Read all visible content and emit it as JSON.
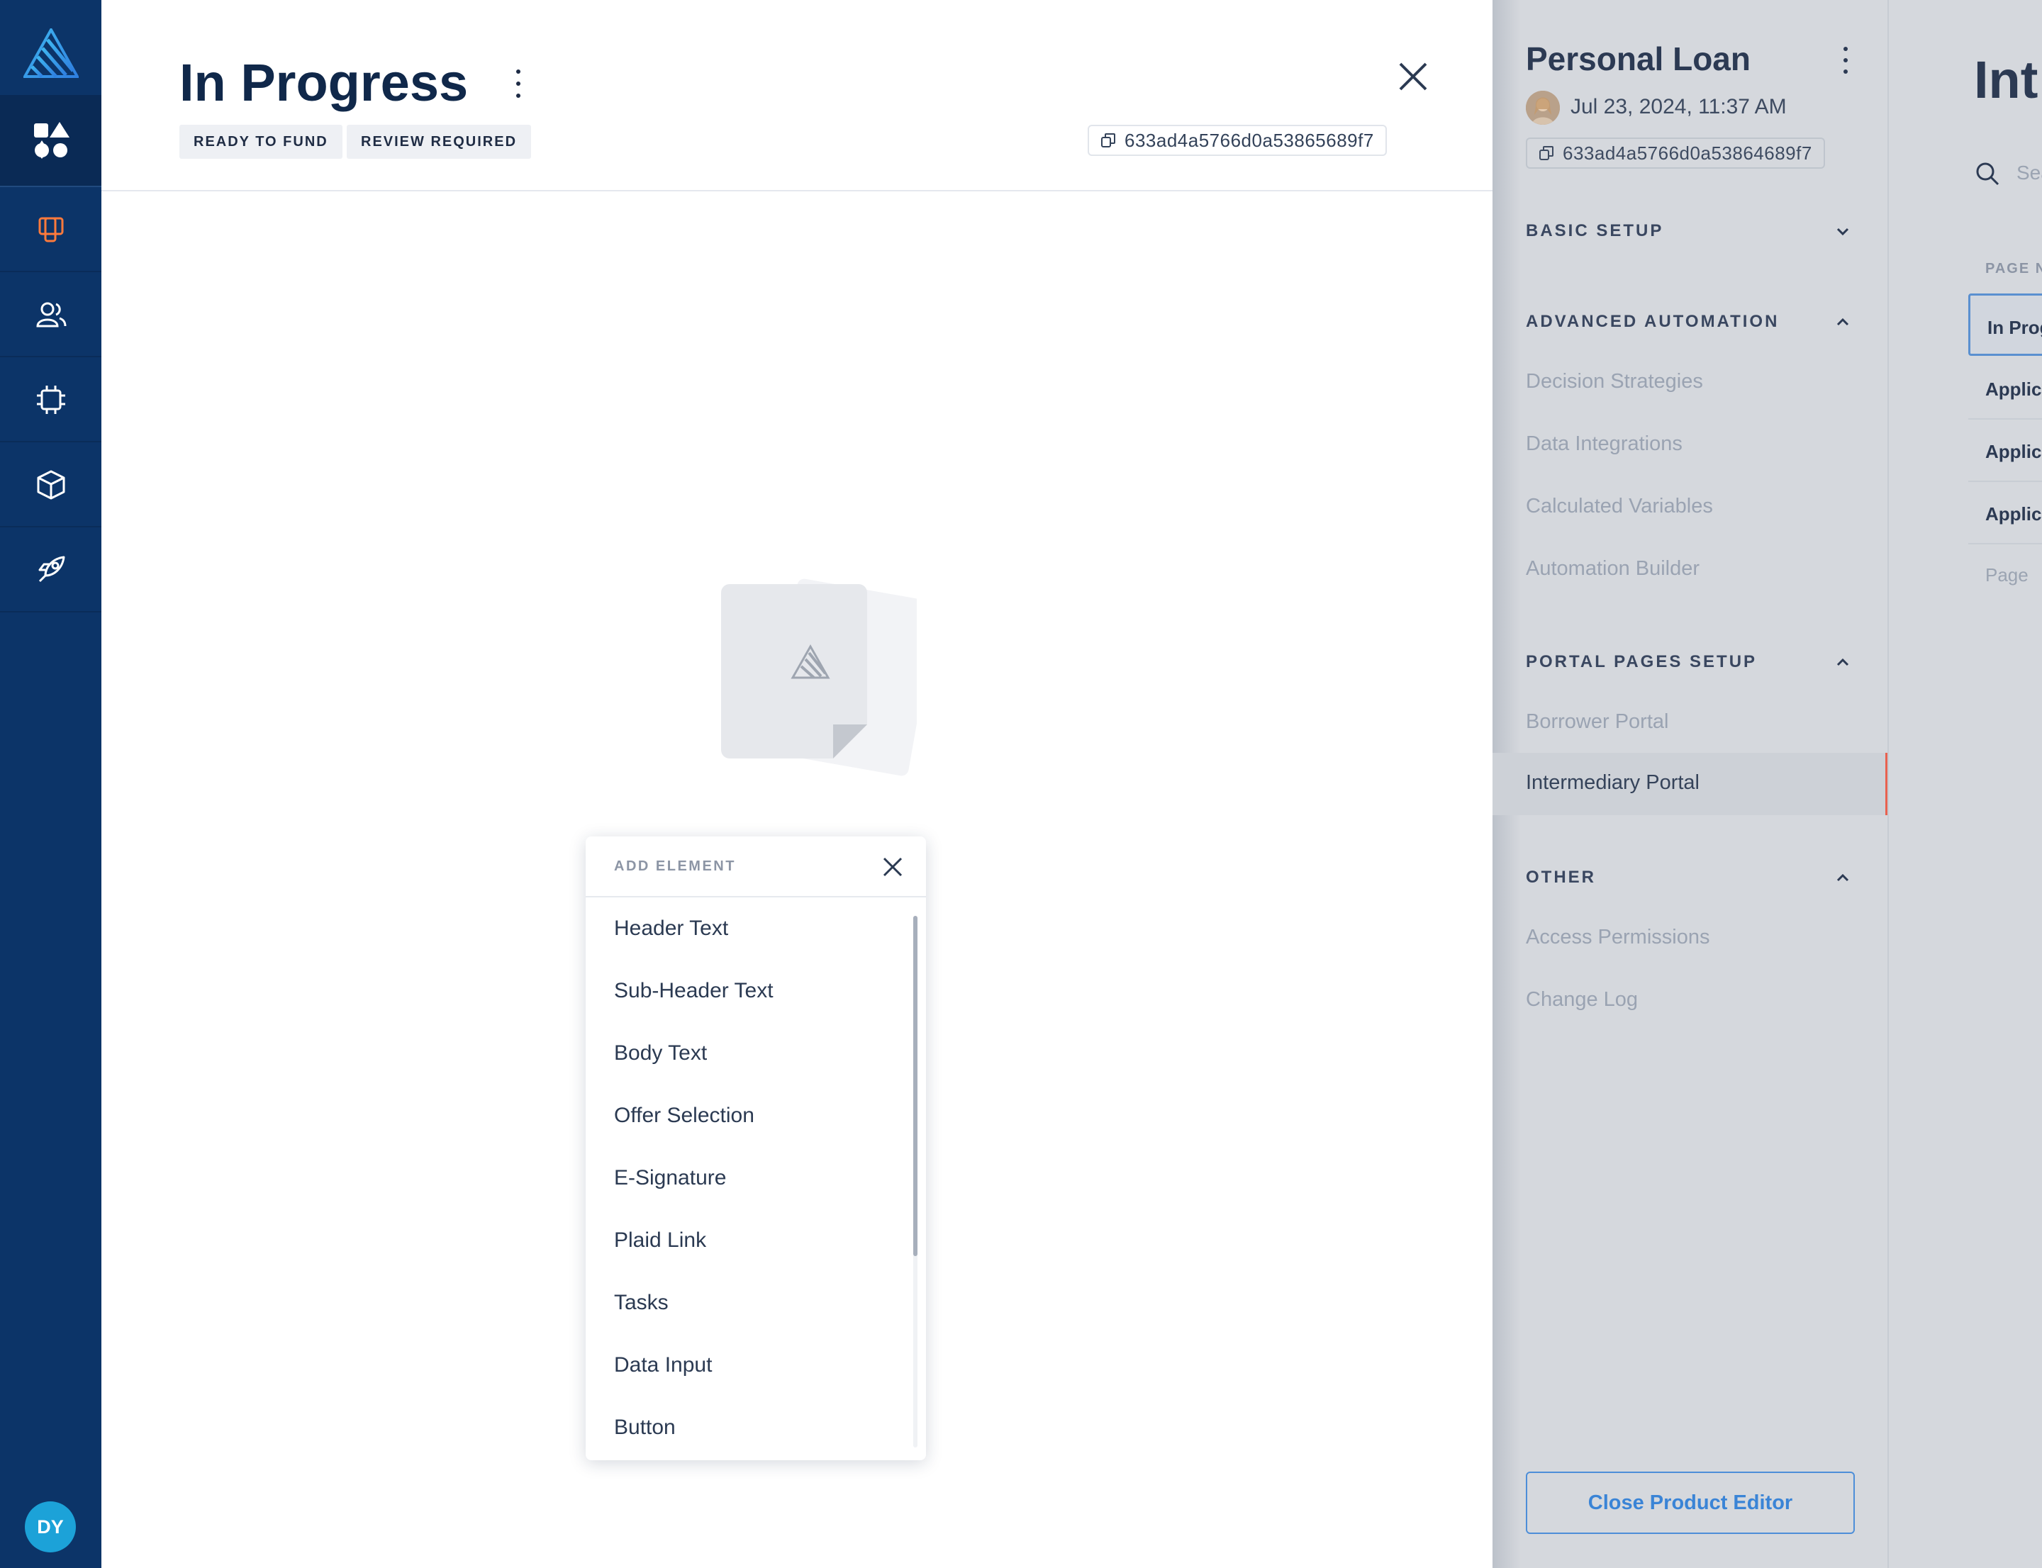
{
  "leftnav": {
    "avatar_initials": "DY",
    "items": [
      "apps-icon",
      "layout-icon",
      "users-icon",
      "chip-icon",
      "cube-icon",
      "rocket-icon"
    ]
  },
  "editor": {
    "title": "In Progress",
    "tags": [
      "READY TO FUND",
      "REVIEW REQUIRED"
    ],
    "id": "633ad4a5766d0a53865689f7"
  },
  "add_element": {
    "title": "ADD ELEMENT",
    "items": [
      "Header Text",
      "Sub-Header Text",
      "Body Text",
      "Offer Selection",
      "E-Signature",
      "Plaid Link",
      "Tasks",
      "Data Input",
      "Button"
    ]
  },
  "product_panel": {
    "title": "Personal Loan",
    "date": "Jul 23, 2024, 11:37 AM",
    "id": "633ad4a5766d0a53864689f7",
    "sections": {
      "basic": "BASIC SETUP",
      "advanced": "ADVANCED AUTOMATION",
      "portal": "PORTAL PAGES SETUP",
      "other": "OTHER"
    },
    "advanced_items": [
      "Decision Strategies",
      "Data Integrations",
      "Calculated Variables",
      "Automation Builder"
    ],
    "portal_items": [
      "Borrower Portal",
      "Intermediary Portal"
    ],
    "other_items": [
      "Access Permissions",
      "Change Log"
    ],
    "close_button": "Close Product Editor"
  },
  "far_panel": {
    "title": "Int",
    "search_placeholder": "Sea",
    "column_header": "PAGE N",
    "rows": [
      "In Prog",
      "Applic",
      "Applic",
      "Applic"
    ],
    "add_row": "Page"
  },
  "colors": {
    "nav_bg": "#0c3468",
    "accent_orange": "#fe7a3c",
    "active_red": "#e8614f",
    "button_blue": "#3a84d6"
  }
}
